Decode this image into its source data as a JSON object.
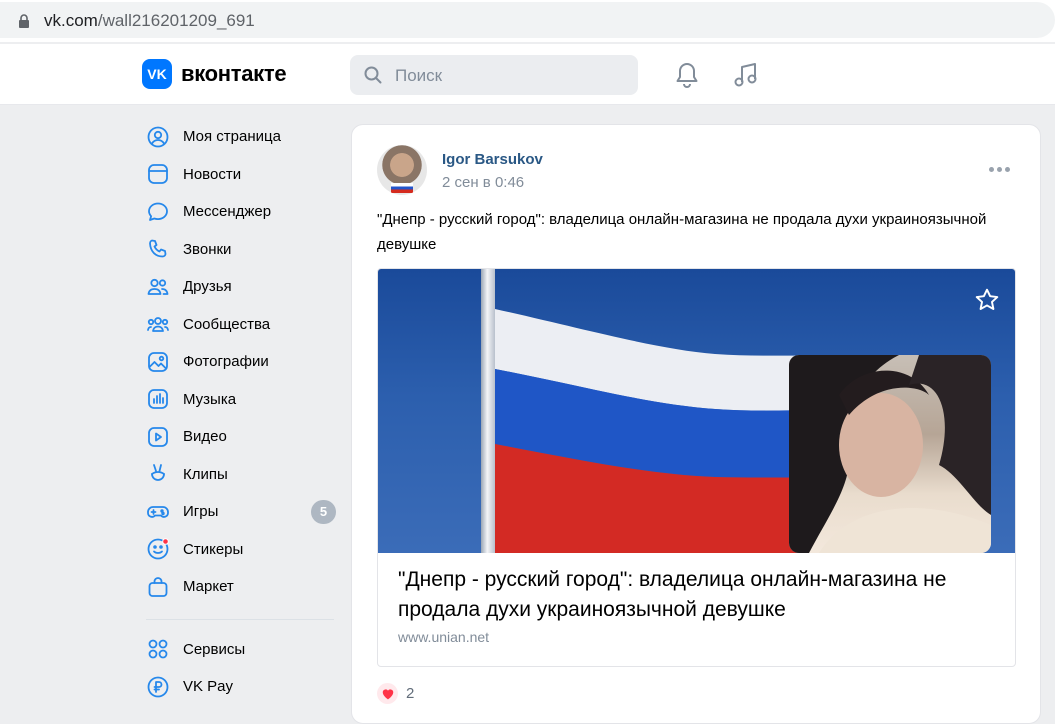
{
  "browser": {
    "url_host": "vk.com",
    "url_path": "/wall216201209_691"
  },
  "header": {
    "logo_mark": "VK",
    "logo_text": "вконтакте",
    "search_placeholder": "Поиск"
  },
  "sidebar": {
    "items": [
      {
        "label": "Моя страница",
        "icon": "user-circle-icon"
      },
      {
        "label": "Новости",
        "icon": "newsfeed-icon"
      },
      {
        "label": "Мессенджер",
        "icon": "message-icon"
      },
      {
        "label": "Звонки",
        "icon": "phone-icon"
      },
      {
        "label": "Друзья",
        "icon": "friends-icon"
      },
      {
        "label": "Сообщества",
        "icon": "communities-icon"
      },
      {
        "label": "Фотографии",
        "icon": "photo-icon"
      },
      {
        "label": "Музыка",
        "icon": "music-icon"
      },
      {
        "label": "Видео",
        "icon": "video-icon"
      },
      {
        "label": "Клипы",
        "icon": "clips-icon"
      },
      {
        "label": "Игры",
        "icon": "games-icon",
        "badge": "5"
      },
      {
        "label": "Стикеры",
        "icon": "stickers-icon"
      },
      {
        "label": "Маркет",
        "icon": "market-icon"
      }
    ],
    "extra": [
      {
        "label": "Сервисы",
        "icon": "services-icon"
      },
      {
        "label": "VK Pay",
        "icon": "vkpay-icon"
      }
    ]
  },
  "post": {
    "author": "Igor Barsukov",
    "date": "2 сен в 0:46",
    "text": "\"Днепр - русский город\": владелица онлайн-магазина не продала духи украиноязычной девушке",
    "card": {
      "title": "\"Днепр - русский город\": владелица онлайн-магазина не продала духи украиноязычной девушке",
      "source": "www.unian.net"
    },
    "likes": "2"
  },
  "colors": {
    "accent": "#0077ff",
    "link": "#2a5885",
    "muted": "#818c99",
    "like": "#ff3347"
  }
}
